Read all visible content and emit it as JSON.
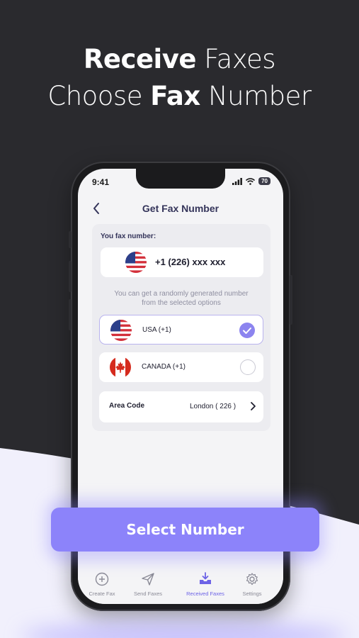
{
  "headline": {
    "line1_bold": "Receive",
    "line1_light": "Faxes",
    "line2_light": "Choose",
    "line2_bold": "Fax",
    "line2_end": "Number"
  },
  "status_bar": {
    "time": "9:41",
    "battery": "70"
  },
  "nav": {
    "title": "Get Fax Number",
    "back_icon": "chevron-left-icon"
  },
  "fax_card": {
    "label": "You fax number:",
    "number": "+1 (226) xxx xxx",
    "hint_line1": "You can get a randomly generated number",
    "hint_line2": "from the selected options"
  },
  "options": [
    {
      "label": "USA (+1)",
      "selected": true,
      "flag": "us-flag-icon"
    },
    {
      "label": "CANADA (+1)",
      "selected": false,
      "flag": "canada-flag-icon"
    }
  ],
  "area_code": {
    "label": "Area Code",
    "value": "London ( 226 )"
  },
  "cta": {
    "label": "Select Number"
  },
  "tabs": [
    {
      "label": "Create Fax",
      "icon": "plus-circle-icon",
      "active": false
    },
    {
      "label": "Send Faxes",
      "icon": "paper-plane-icon",
      "active": false
    },
    {
      "label": "Received Faxes",
      "icon": "inbox-download-icon",
      "active": true
    },
    {
      "label": "Settings",
      "icon": "gear-icon",
      "active": false
    }
  ],
  "colors": {
    "accent": "#8c83fa",
    "dark_bg": "#2a2a2e",
    "light_bg": "#f1f0fc"
  }
}
